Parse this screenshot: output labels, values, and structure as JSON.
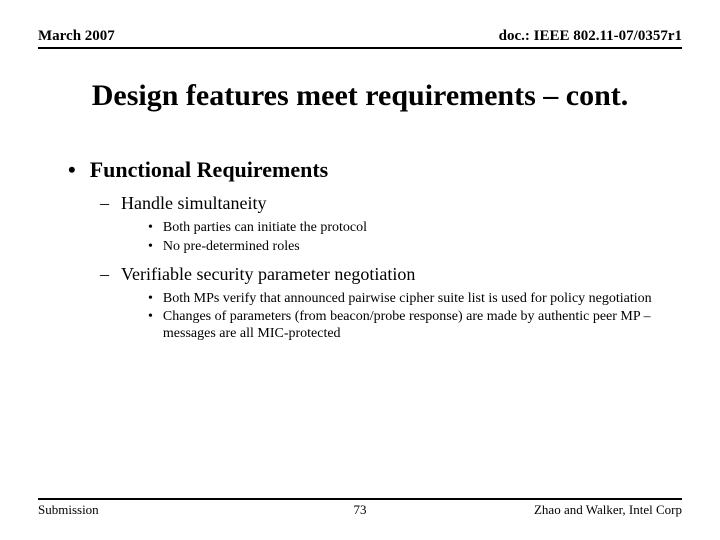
{
  "header": {
    "date": "March 2007",
    "doc": "doc.: IEEE 802.11-07/0357r1"
  },
  "title": "Design features meet requirements – cont.",
  "section_heading": "Functional Requirements",
  "items": [
    {
      "label": "Handle simultaneity",
      "subs": [
        "Both parties can initiate the protocol",
        "No pre-determined roles"
      ]
    },
    {
      "label": "Verifiable security parameter negotiation",
      "subs": [
        "Both MPs verify that announced pairwise cipher suite list is used for policy negotiation",
        "Changes of parameters (from beacon/probe response) are made by authentic peer MP – messages are all MIC-protected"
      ]
    }
  ],
  "footer": {
    "left": "Submission",
    "center": "73",
    "right": "Zhao and Walker, Intel Corp"
  }
}
